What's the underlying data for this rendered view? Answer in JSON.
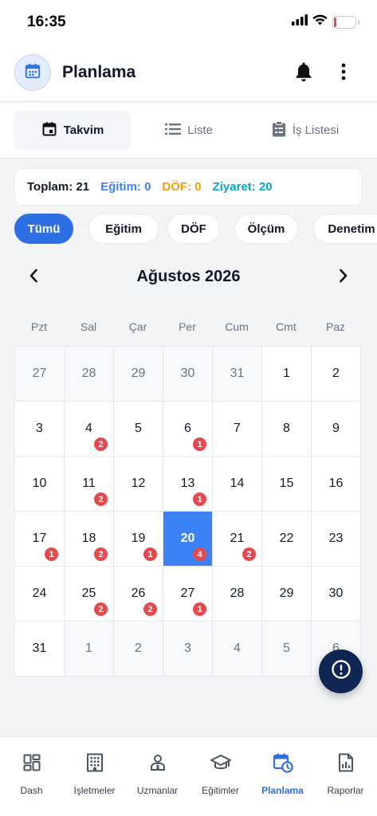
{
  "status_bar": {
    "time": "16:35",
    "battery": "12",
    "battery_level": 0.12
  },
  "header": {
    "title": "Planlama"
  },
  "view_tabs": [
    {
      "label": "Takvim",
      "icon": "calendar-icon",
      "active": true
    },
    {
      "label": "Liste",
      "icon": "list-icon",
      "active": false
    },
    {
      "label": "İş Listesi",
      "icon": "clipboard-icon",
      "active": false
    }
  ],
  "summary": {
    "total": "Toplam: 21",
    "egitim": "Eğitim: 0",
    "dof": "DÖF: 0",
    "ziyaret": "Ziyaret: 20"
  },
  "filters": [
    {
      "label": "Tümü",
      "active": true
    },
    {
      "label": "Eğitim",
      "active": false
    },
    {
      "label": "DÖF",
      "active": false
    },
    {
      "label": "Ölçüm",
      "active": false
    },
    {
      "label": "Denetim",
      "active": false
    }
  ],
  "calendar": {
    "month_title": "Ağustos 2026",
    "weekdays": [
      "Pzt",
      "Sal",
      "Çar",
      "Per",
      "Cum",
      "Cmt",
      "Paz"
    ],
    "days": [
      {
        "day": "27",
        "current": false,
        "count": ""
      },
      {
        "day": "28",
        "current": false,
        "count": ""
      },
      {
        "day": "29",
        "current": false,
        "count": ""
      },
      {
        "day": "30",
        "current": false,
        "count": ""
      },
      {
        "day": "31",
        "current": false,
        "count": ""
      },
      {
        "day": "1",
        "current": true,
        "count": ""
      },
      {
        "day": "2",
        "current": true,
        "count": ""
      },
      {
        "day": "3",
        "current": true,
        "count": ""
      },
      {
        "day": "4",
        "current": true,
        "count": "2"
      },
      {
        "day": "5",
        "current": true,
        "count": ""
      },
      {
        "day": "6",
        "current": true,
        "count": "1"
      },
      {
        "day": "7",
        "current": true,
        "count": ""
      },
      {
        "day": "8",
        "current": true,
        "count": ""
      },
      {
        "day": "9",
        "current": true,
        "count": ""
      },
      {
        "day": "10",
        "current": true,
        "count": ""
      },
      {
        "day": "11",
        "current": true,
        "count": "2"
      },
      {
        "day": "12",
        "current": true,
        "count": ""
      },
      {
        "day": "13",
        "current": true,
        "count": "1"
      },
      {
        "day": "14",
        "current": true,
        "count": ""
      },
      {
        "day": "15",
        "current": true,
        "count": ""
      },
      {
        "day": "16",
        "current": true,
        "count": ""
      },
      {
        "day": "17",
        "current": true,
        "count": "1"
      },
      {
        "day": "18",
        "current": true,
        "count": "2"
      },
      {
        "day": "19",
        "current": true,
        "count": "1"
      },
      {
        "day": "20",
        "current": true,
        "count": "4",
        "selected": true
      },
      {
        "day": "21",
        "current": true,
        "count": "2"
      },
      {
        "day": "22",
        "current": true,
        "count": ""
      },
      {
        "day": "23",
        "current": true,
        "count": ""
      },
      {
        "day": "24",
        "current": true,
        "count": ""
      },
      {
        "day": "25",
        "current": true,
        "count": "2"
      },
      {
        "day": "26",
        "current": true,
        "count": "2"
      },
      {
        "day": "27",
        "current": true,
        "count": "1"
      },
      {
        "day": "28",
        "current": true,
        "count": ""
      },
      {
        "day": "29",
        "current": true,
        "count": ""
      },
      {
        "day": "30",
        "current": true,
        "count": ""
      },
      {
        "day": "31",
        "current": true,
        "count": ""
      },
      {
        "day": "1",
        "current": false,
        "count": ""
      },
      {
        "day": "2",
        "current": false,
        "count": ""
      },
      {
        "day": "3",
        "current": false,
        "count": ""
      },
      {
        "day": "4",
        "current": false,
        "count": ""
      },
      {
        "day": "5",
        "current": false,
        "count": ""
      },
      {
        "day": "6",
        "current": false,
        "count": ""
      }
    ]
  },
  "bottom_nav": [
    {
      "label": "Dash",
      "icon": "dashboard-icon",
      "active": false
    },
    {
      "label": "İşletmeler",
      "icon": "building-icon",
      "active": false
    },
    {
      "label": "Uzmanlar",
      "icon": "users-icon",
      "active": false
    },
    {
      "label": "Eğitimler",
      "icon": "graduation-cap-icon",
      "active": false
    },
    {
      "label": "Planlama",
      "icon": "calendar-clock-icon",
      "active": true
    },
    {
      "label": "Raporlar",
      "icon": "report-icon",
      "active": false
    }
  ],
  "colors": {
    "primary": "#2f6fe4",
    "selected_day": "#3b82f6",
    "badge": "#e5484d",
    "egitim": "#3b82f6",
    "dof": "#f59e0b",
    "ziyaret": "#06a6c8",
    "fab": "#0f2554"
  }
}
